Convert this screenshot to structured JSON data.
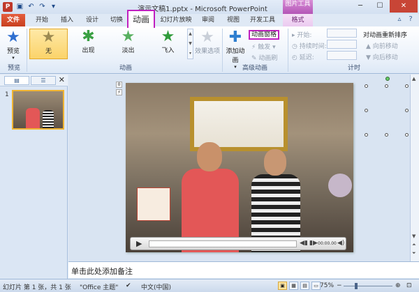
{
  "titlebar": {
    "app_icon": "P",
    "title": "演示文稿1.pptx - Microsoft PowerPoint",
    "picture_tools": "图片工具",
    "qat": [
      "save-icon",
      "undo-icon",
      "redo-icon",
      "customize-icon"
    ]
  },
  "tabs": {
    "file": "文件",
    "home": "开始",
    "insert": "插入",
    "design": "设计",
    "transitions": "切换",
    "animations": "动画",
    "slideshow": "幻灯片放映",
    "review": "审阅",
    "view": "视图",
    "developer": "开发工具",
    "format": "格式"
  },
  "ribbon": {
    "preview": {
      "label": "预览",
      "group": "预览"
    },
    "animation_gallery": {
      "items": [
        "无",
        "出现",
        "淡出",
        "飞入"
      ],
      "selected_index": 0,
      "group": "动画"
    },
    "effect_options": "效果选项",
    "advanced": {
      "add_animation": "添加动画",
      "animation_pane": "动画窗格",
      "trigger": "触发",
      "animation_painter": "动画刷",
      "group": "高级动画"
    },
    "timing": {
      "start": "开始:",
      "duration": "持续时间:",
      "delay": "延迟:",
      "reorder": "对动画重新排序",
      "move_earlier": "向前移动",
      "move_later": "向后移动",
      "group": "计时"
    }
  },
  "left_panel": {
    "slide_number": "1"
  },
  "player": {
    "time": "00:00.00"
  },
  "notes": {
    "placeholder": "单击此处添加备注"
  },
  "status": {
    "slide_info": "幻灯片 第 1 张，共 1 张",
    "theme": "\"Office 主题\"",
    "language": "中文(中国)",
    "zoom": "75%"
  }
}
